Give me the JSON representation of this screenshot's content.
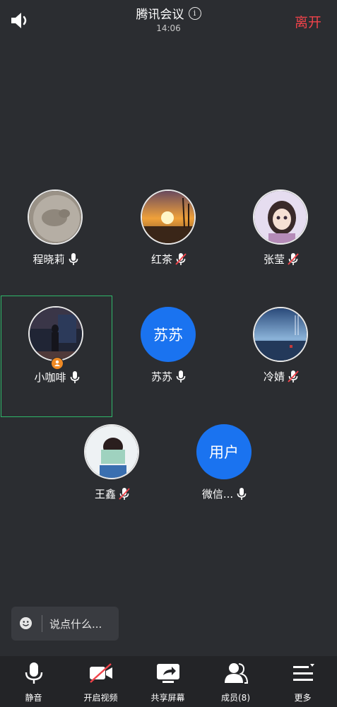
{
  "header": {
    "title": "腾讯会议",
    "info_icon": "i",
    "time": "14:06",
    "leave_label": "离开"
  },
  "participants": [
    {
      "name": "程晓莉",
      "avatar": "photo-coin",
      "mic": "on"
    },
    {
      "name": "红茶",
      "avatar": "photo-sunset",
      "mic": "muted"
    },
    {
      "name": "张莹",
      "avatar": "photo-anime",
      "mic": "muted"
    },
    {
      "name": "小咖啡",
      "avatar": "photo-person",
      "mic": "on",
      "active": true,
      "host": true
    },
    {
      "name": "苏苏",
      "avatar_text": "苏苏",
      "mic": "on"
    },
    {
      "name": "冷婧",
      "avatar": "photo-sea",
      "mic": "muted"
    },
    {
      "name": "王鑫",
      "avatar": "photo-book",
      "mic": "muted"
    },
    {
      "name": "微信...",
      "avatar_text": "用户",
      "mic": "on"
    }
  ],
  "chat": {
    "placeholder": "说点什么..."
  },
  "toolbar": [
    {
      "label": "静音",
      "icon": "mic-icon"
    },
    {
      "label": "开启视频",
      "icon": "video-off-icon"
    },
    {
      "label": "共享屏幕",
      "icon": "share-screen-icon"
    },
    {
      "label": "成员(8)",
      "icon": "members-icon"
    },
    {
      "label": "更多",
      "icon": "more-icon"
    }
  ],
  "colors": {
    "accent": "#1a73f0",
    "leave": "#f0434a",
    "active_border": "#2fb86a",
    "background": "#2b2d31"
  }
}
